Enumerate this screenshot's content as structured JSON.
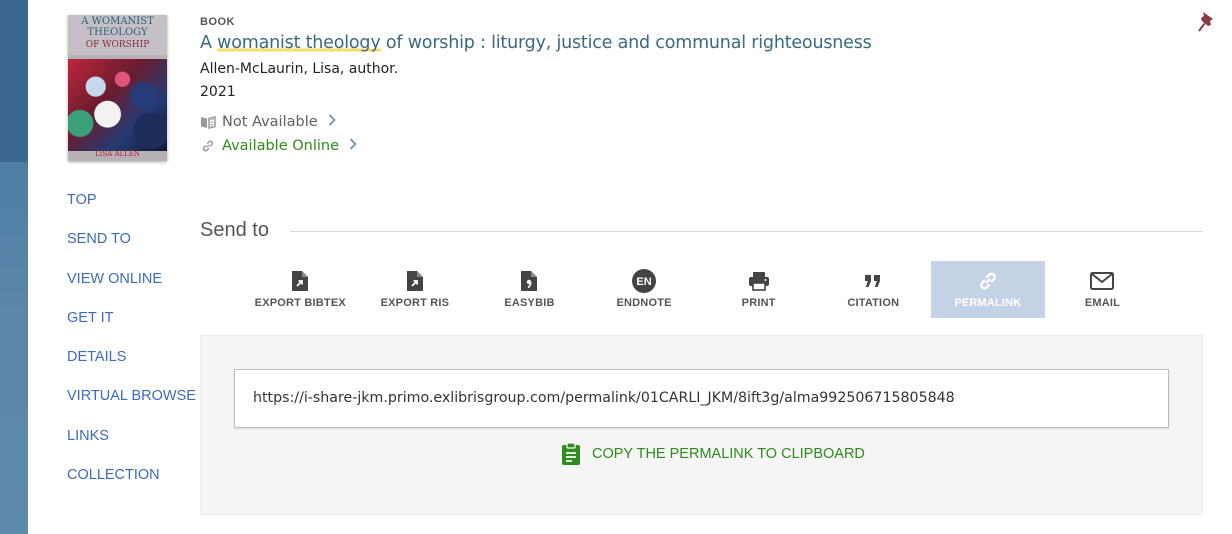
{
  "record": {
    "type": "BOOK",
    "title_highlight": "womanist theology",
    "title_prefix": "A ",
    "title_suffix": " of worship : liturgy, justice and communal righteousness",
    "author": "Allen-McLaurin, Lisa, author.",
    "year": "2021",
    "availability_print": "Not Available",
    "availability_online": "Available Online"
  },
  "cover": {
    "line1": "A WOMANIST",
    "line2": "THEOLOGY",
    "line3": "OF WORSHIP",
    "author": "LISA ALLEN"
  },
  "nav": {
    "items": [
      "TOP",
      "SEND TO",
      "VIEW ONLINE",
      "GET IT",
      "DETAILS",
      "VIRTUAL BROWSE",
      "LINKS",
      "COLLECTION"
    ]
  },
  "sendto": {
    "heading": "Send to",
    "actions": [
      {
        "label": "EXPORT BIBTEX",
        "icon": "export-icon"
      },
      {
        "label": "EXPORT RIS",
        "icon": "export-icon"
      },
      {
        "label": "EASYBIB",
        "icon": "easybib-icon"
      },
      {
        "label": "ENDNOTE",
        "icon": "endnote-icon",
        "badge": "EN"
      },
      {
        "label": "PRINT",
        "icon": "printer-icon"
      },
      {
        "label": "CITATION",
        "icon": "quote-icon"
      },
      {
        "label": "PERMALINK",
        "icon": "link-icon",
        "active": true
      },
      {
        "label": "EMAIL",
        "icon": "envelope-icon"
      }
    ]
  },
  "permalink": {
    "url": "https://i-share-jkm.primo.exlibrisgroup.com/permalink/01CARLI_JKM/8ift3g/alma992506715805848",
    "copy_label": "COPY THE PERMALINK TO CLIPBOARD"
  },
  "colors": {
    "title": "#39687f",
    "highlight": "#f5dd69",
    "nav_link": "#3d6bb7",
    "available_online": "#2e8b1c",
    "active_action_bg": "#c5d2e6",
    "sidebar_bg": "#4f7ea3"
  }
}
